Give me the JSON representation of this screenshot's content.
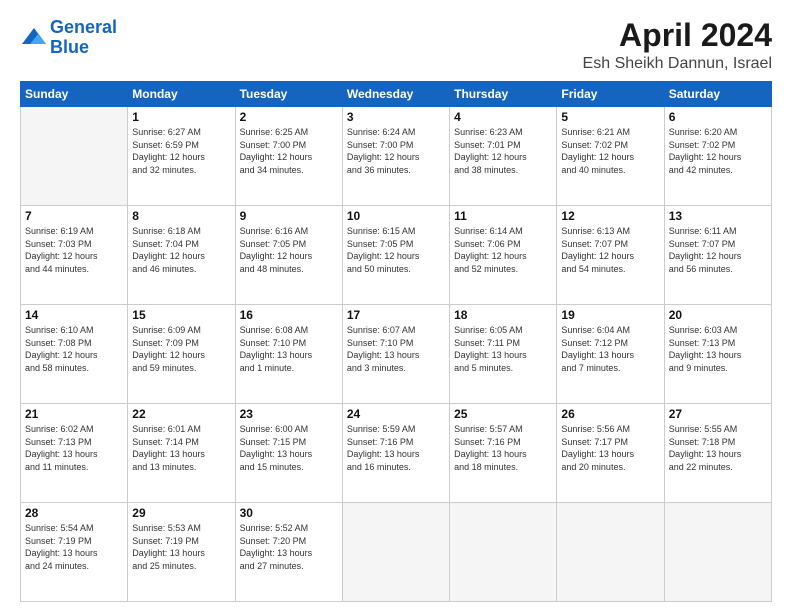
{
  "header": {
    "logo_line1": "General",
    "logo_line2": "Blue",
    "month": "April 2024",
    "location": "Esh Sheikh Dannun, Israel"
  },
  "days_of_week": [
    "Sunday",
    "Monday",
    "Tuesday",
    "Wednesday",
    "Thursday",
    "Friday",
    "Saturday"
  ],
  "weeks": [
    [
      {
        "num": "",
        "info": ""
      },
      {
        "num": "1",
        "info": "Sunrise: 6:27 AM\nSunset: 6:59 PM\nDaylight: 12 hours\nand 32 minutes."
      },
      {
        "num": "2",
        "info": "Sunrise: 6:25 AM\nSunset: 7:00 PM\nDaylight: 12 hours\nand 34 minutes."
      },
      {
        "num": "3",
        "info": "Sunrise: 6:24 AM\nSunset: 7:00 PM\nDaylight: 12 hours\nand 36 minutes."
      },
      {
        "num": "4",
        "info": "Sunrise: 6:23 AM\nSunset: 7:01 PM\nDaylight: 12 hours\nand 38 minutes."
      },
      {
        "num": "5",
        "info": "Sunrise: 6:21 AM\nSunset: 7:02 PM\nDaylight: 12 hours\nand 40 minutes."
      },
      {
        "num": "6",
        "info": "Sunrise: 6:20 AM\nSunset: 7:02 PM\nDaylight: 12 hours\nand 42 minutes."
      }
    ],
    [
      {
        "num": "7",
        "info": "Sunrise: 6:19 AM\nSunset: 7:03 PM\nDaylight: 12 hours\nand 44 minutes."
      },
      {
        "num": "8",
        "info": "Sunrise: 6:18 AM\nSunset: 7:04 PM\nDaylight: 12 hours\nand 46 minutes."
      },
      {
        "num": "9",
        "info": "Sunrise: 6:16 AM\nSunset: 7:05 PM\nDaylight: 12 hours\nand 48 minutes."
      },
      {
        "num": "10",
        "info": "Sunrise: 6:15 AM\nSunset: 7:05 PM\nDaylight: 12 hours\nand 50 minutes."
      },
      {
        "num": "11",
        "info": "Sunrise: 6:14 AM\nSunset: 7:06 PM\nDaylight: 12 hours\nand 52 minutes."
      },
      {
        "num": "12",
        "info": "Sunrise: 6:13 AM\nSunset: 7:07 PM\nDaylight: 12 hours\nand 54 minutes."
      },
      {
        "num": "13",
        "info": "Sunrise: 6:11 AM\nSunset: 7:07 PM\nDaylight: 12 hours\nand 56 minutes."
      }
    ],
    [
      {
        "num": "14",
        "info": "Sunrise: 6:10 AM\nSunset: 7:08 PM\nDaylight: 12 hours\nand 58 minutes."
      },
      {
        "num": "15",
        "info": "Sunrise: 6:09 AM\nSunset: 7:09 PM\nDaylight: 12 hours\nand 59 minutes."
      },
      {
        "num": "16",
        "info": "Sunrise: 6:08 AM\nSunset: 7:10 PM\nDaylight: 13 hours\nand 1 minute."
      },
      {
        "num": "17",
        "info": "Sunrise: 6:07 AM\nSunset: 7:10 PM\nDaylight: 13 hours\nand 3 minutes."
      },
      {
        "num": "18",
        "info": "Sunrise: 6:05 AM\nSunset: 7:11 PM\nDaylight: 13 hours\nand 5 minutes."
      },
      {
        "num": "19",
        "info": "Sunrise: 6:04 AM\nSunset: 7:12 PM\nDaylight: 13 hours\nand 7 minutes."
      },
      {
        "num": "20",
        "info": "Sunrise: 6:03 AM\nSunset: 7:13 PM\nDaylight: 13 hours\nand 9 minutes."
      }
    ],
    [
      {
        "num": "21",
        "info": "Sunrise: 6:02 AM\nSunset: 7:13 PM\nDaylight: 13 hours\nand 11 minutes."
      },
      {
        "num": "22",
        "info": "Sunrise: 6:01 AM\nSunset: 7:14 PM\nDaylight: 13 hours\nand 13 minutes."
      },
      {
        "num": "23",
        "info": "Sunrise: 6:00 AM\nSunset: 7:15 PM\nDaylight: 13 hours\nand 15 minutes."
      },
      {
        "num": "24",
        "info": "Sunrise: 5:59 AM\nSunset: 7:16 PM\nDaylight: 13 hours\nand 16 minutes."
      },
      {
        "num": "25",
        "info": "Sunrise: 5:57 AM\nSunset: 7:16 PM\nDaylight: 13 hours\nand 18 minutes."
      },
      {
        "num": "26",
        "info": "Sunrise: 5:56 AM\nSunset: 7:17 PM\nDaylight: 13 hours\nand 20 minutes."
      },
      {
        "num": "27",
        "info": "Sunrise: 5:55 AM\nSunset: 7:18 PM\nDaylight: 13 hours\nand 22 minutes."
      }
    ],
    [
      {
        "num": "28",
        "info": "Sunrise: 5:54 AM\nSunset: 7:19 PM\nDaylight: 13 hours\nand 24 minutes."
      },
      {
        "num": "29",
        "info": "Sunrise: 5:53 AM\nSunset: 7:19 PM\nDaylight: 13 hours\nand 25 minutes."
      },
      {
        "num": "30",
        "info": "Sunrise: 5:52 AM\nSunset: 7:20 PM\nDaylight: 13 hours\nand 27 minutes."
      },
      {
        "num": "",
        "info": ""
      },
      {
        "num": "",
        "info": ""
      },
      {
        "num": "",
        "info": ""
      },
      {
        "num": "",
        "info": ""
      }
    ]
  ]
}
